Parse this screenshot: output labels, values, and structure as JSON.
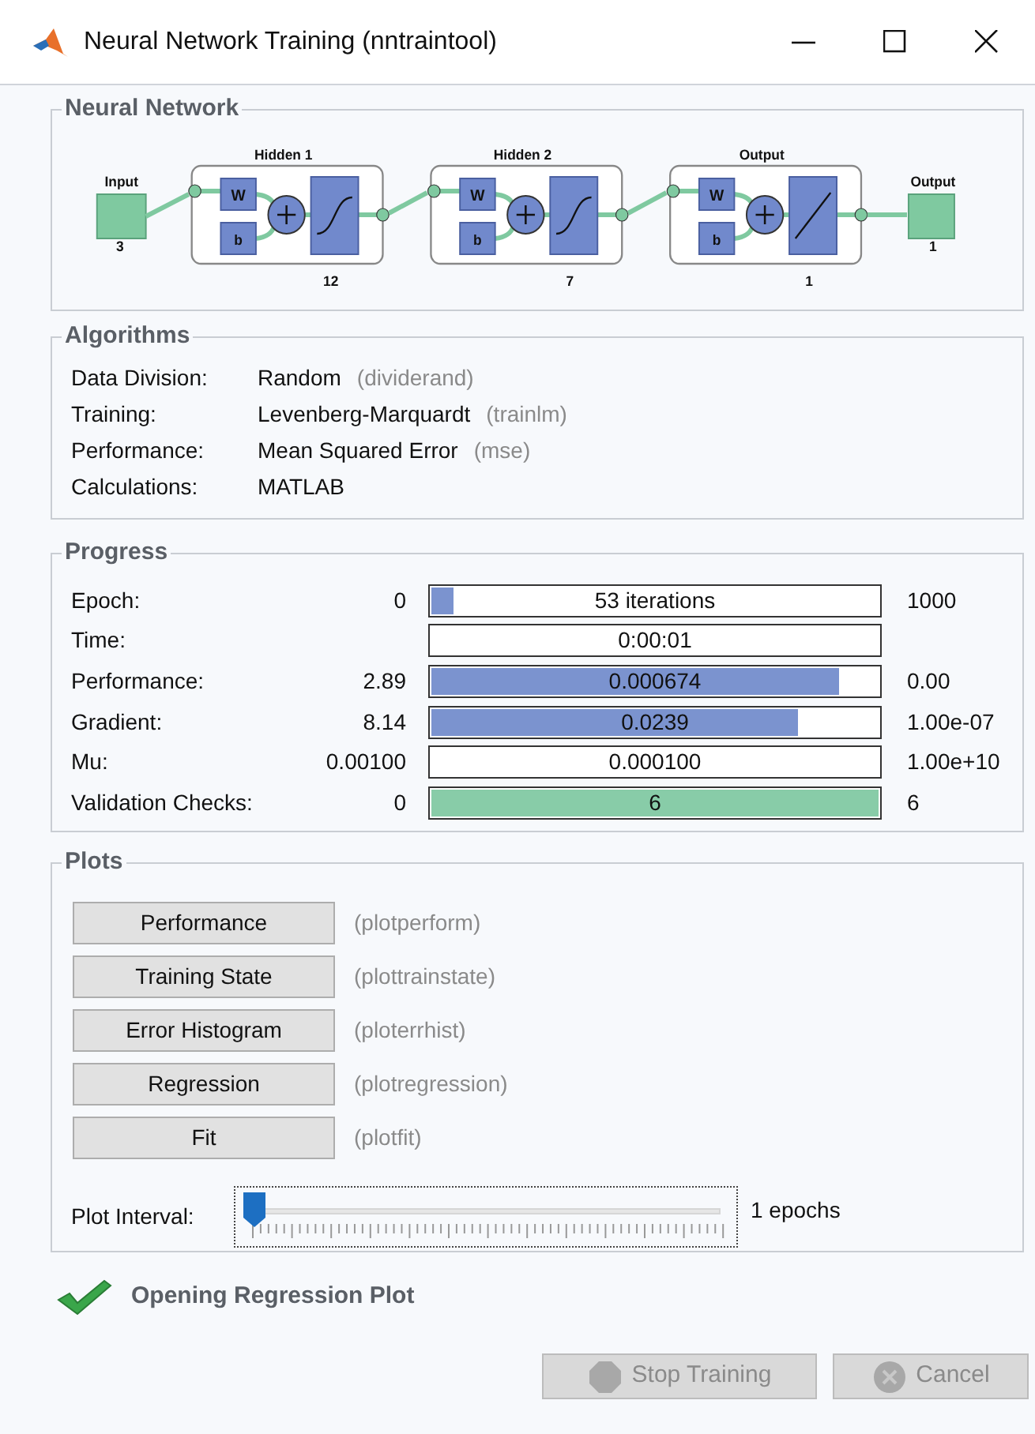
{
  "window": {
    "title": "Neural Network Training (nntraintool)"
  },
  "neural_network": {
    "title": "Neural Network",
    "input": {
      "label": "Input",
      "size": "3"
    },
    "layers": [
      {
        "title": "Hidden 1",
        "size": "12",
        "weight": "W",
        "bias": "b",
        "kind": "sigmoid"
      },
      {
        "title": "Hidden 2",
        "size": "7",
        "weight": "W",
        "bias": "b",
        "kind": "sigmoid"
      },
      {
        "title": "Output",
        "size": "1",
        "weight": "W",
        "bias": "b",
        "kind": "linear"
      }
    ],
    "output": {
      "label": "Output",
      "size": "1"
    }
  },
  "algorithms": {
    "title": "Algorithms",
    "rows": [
      {
        "label": "Data Division:",
        "value": "Random",
        "function": "(dividerand)"
      },
      {
        "label": "Training:",
        "value": "Levenberg-Marquardt",
        "function": "(trainlm)"
      },
      {
        "label": "Performance:",
        "value": "Mean Squared Error",
        "function": "(mse)"
      },
      {
        "label": "Calculations:",
        "value": "MATLAB"
      }
    ]
  },
  "progress": {
    "title": "Progress",
    "rows": [
      {
        "label": "Epoch:",
        "start": "0",
        "reading": "53 iterations",
        "end": "1000",
        "level": 0.05,
        "color": "#7b93cf"
      },
      {
        "label": "Time:",
        "reading": "0:00:01"
      },
      {
        "label": "Performance:",
        "start": "2.89",
        "reading": "0.000674",
        "end": "0.00",
        "level": 0.91,
        "color": "#7b93cf"
      },
      {
        "label": "Gradient:",
        "start": "8.14",
        "reading": "0.0239",
        "end": "1.00e-07",
        "level": 0.82,
        "color": "#7b93cf"
      },
      {
        "label": "Mu:",
        "start": "0.00100",
        "reading": "0.000100",
        "end": "1.00e+10"
      },
      {
        "label": "Validation Checks:",
        "start": "0",
        "reading": "6",
        "end": "6",
        "level": 1,
        "color": "#88cca8"
      }
    ]
  },
  "plots": {
    "title": "Plots",
    "buttons": [
      {
        "label": "Performance",
        "function": "(plotperform)"
      },
      {
        "label": "Training State",
        "function": "(plottrainstate)"
      },
      {
        "label": "Error Histogram",
        "function": "(ploterrhist)"
      },
      {
        "label": "Regression",
        "function": "(plotregression)"
      },
      {
        "label": "Fit",
        "function": "(plotfit)"
      }
    ],
    "interval": {
      "label": "Plot Interval:",
      "level": 0,
      "reading": "1 epochs"
    }
  },
  "status": {
    "text": "Opening Regression Plot",
    "done": true
  },
  "buttons": [
    {
      "label": "Stop Training",
      "kind": "stop",
      "disabled": true
    },
    {
      "label": "Cancel",
      "kind": "cancel",
      "disabled": true
    }
  ]
}
